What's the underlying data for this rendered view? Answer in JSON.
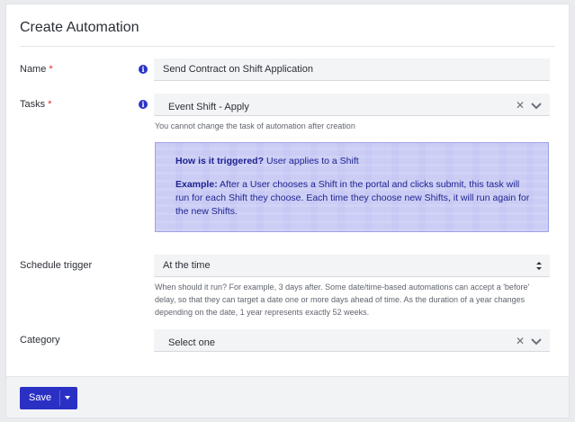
{
  "modal": {
    "title": "Create Automation"
  },
  "form": {
    "name": {
      "label": "Name",
      "required_mark": "*",
      "value": "Send Contract on Shift Application"
    },
    "tasks": {
      "label": "Tasks",
      "required_mark": "*",
      "value": "Event Shift - Apply",
      "help": "You cannot change the task of automation after creation"
    },
    "callout": {
      "trigger_heading": "How is it triggered?",
      "trigger_text": "User applies to a Shift",
      "example_heading": "Example:",
      "example_text": "After a User chooses a Shift in the portal and clicks submit, this task will run for each Shift they choose. Each time they choose new Shifts, it will run again for the new Shifts."
    },
    "schedule_trigger": {
      "label": "Schedule trigger",
      "value": "At the time",
      "help": "When should it run? For example, 3 days after. Some date/time-based automations can accept a 'before' delay, so that they can target a date one or more days ahead of time. As the duration of a year changes depending on the date, 1 year represents exactly 52 weeks."
    },
    "category": {
      "label": "Category",
      "value": "Select one"
    }
  },
  "footer": {
    "save_label": "Save"
  },
  "colors": {
    "primary": "#2b30c4",
    "required": "#e0282e",
    "callout_bg": "#c7c9f4",
    "callout_text": "#1e2390"
  }
}
